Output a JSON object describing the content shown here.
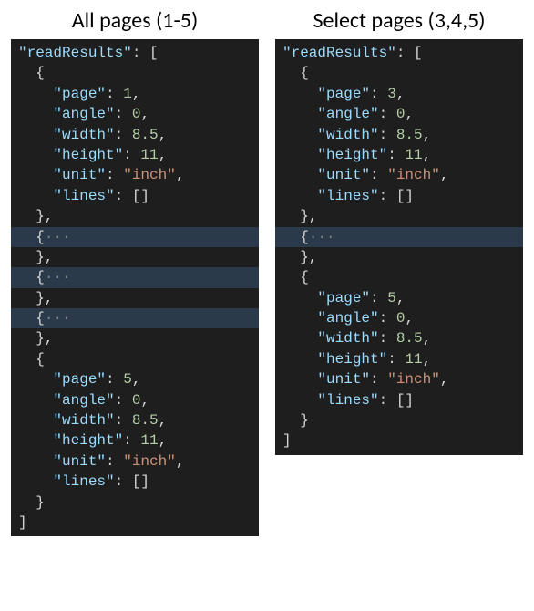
{
  "columns": {
    "left": {
      "title": "All pages (1-5)"
    },
    "right": {
      "title": "Select pages (3,4,5)"
    }
  },
  "code": {
    "readResults_key": "\"readResults\"",
    "colon_open_arr": ": [",
    "open_brace": "{",
    "close_brace": "}",
    "close_brace_comma": "},",
    "close_arr": "]",
    "fold_open": "{",
    "fold_dots": "···",
    "k_page": "\"page\"",
    "k_angle": "\"angle\"",
    "k_width": "\"width\"",
    "k_height": "\"height\"",
    "k_unit": "\"unit\"",
    "k_lines": "\"lines\"",
    "v_page_1": "1",
    "v_page_3": "3",
    "v_page_5": "5",
    "v_angle": "0",
    "v_width": "8.5",
    "v_height": "11",
    "v_unit": "\"inch\"",
    "v_lines": "[]",
    "colon": ": ",
    "comma": ","
  }
}
